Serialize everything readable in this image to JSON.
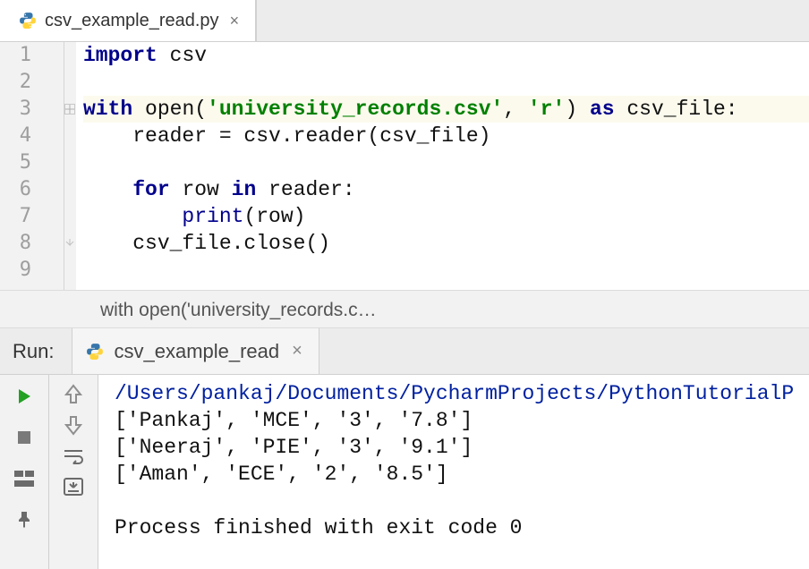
{
  "tab": {
    "filename": "csv_example_read.py"
  },
  "code": {
    "lines": [
      {
        "n": "1",
        "tokens": [
          [
            "kw",
            "import"
          ],
          [
            " "
          ],
          [
            "plain",
            "csv"
          ]
        ]
      },
      {
        "n": "2",
        "tokens": []
      },
      {
        "n": "3",
        "hl": true,
        "tokens": [
          [
            "kw",
            "with"
          ],
          [
            " "
          ],
          [
            "plain",
            "open("
          ],
          [
            "str",
            "'university_records.csv'"
          ],
          [
            "plain",
            ", "
          ],
          [
            "str",
            "'r'"
          ],
          [
            "plain",
            ") "
          ],
          [
            "kw",
            "as"
          ],
          [
            " "
          ],
          [
            "plain",
            "csv_file:"
          ]
        ]
      },
      {
        "n": "4",
        "tokens": [
          [
            "plain",
            "    reader = csv.reader(csv_file)"
          ]
        ]
      },
      {
        "n": "5",
        "tokens": []
      },
      {
        "n": "6",
        "tokens": [
          [
            "plain",
            "    "
          ],
          [
            "kw",
            "for"
          ],
          [
            " "
          ],
          [
            "plain",
            "row "
          ],
          [
            "kw",
            "in"
          ],
          [
            " "
          ],
          [
            "plain",
            "reader:"
          ]
        ]
      },
      {
        "n": "7",
        "tokens": [
          [
            "plain",
            "        "
          ],
          [
            "builtin",
            "print"
          ],
          [
            "plain",
            "(row)"
          ]
        ]
      },
      {
        "n": "8",
        "tokens": [
          [
            "plain",
            "    csv_file.close()"
          ]
        ]
      },
      {
        "n": "9",
        "tokens": []
      }
    ]
  },
  "breadcrumb": {
    "text": "with open('university_records.c…"
  },
  "run": {
    "label": "Run:",
    "tab_name": "csv_example_read",
    "console": {
      "path": "/Users/pankaj/Documents/PycharmProjects/PythonTutorialP",
      "rows": [
        "['Pankaj', 'MCE', '3', '7.8']",
        "['Neeraj', 'PIE', '3', '9.1']",
        "['Aman', 'ECE', '2', '8.5']"
      ],
      "status": "Process finished with exit code 0"
    }
  }
}
